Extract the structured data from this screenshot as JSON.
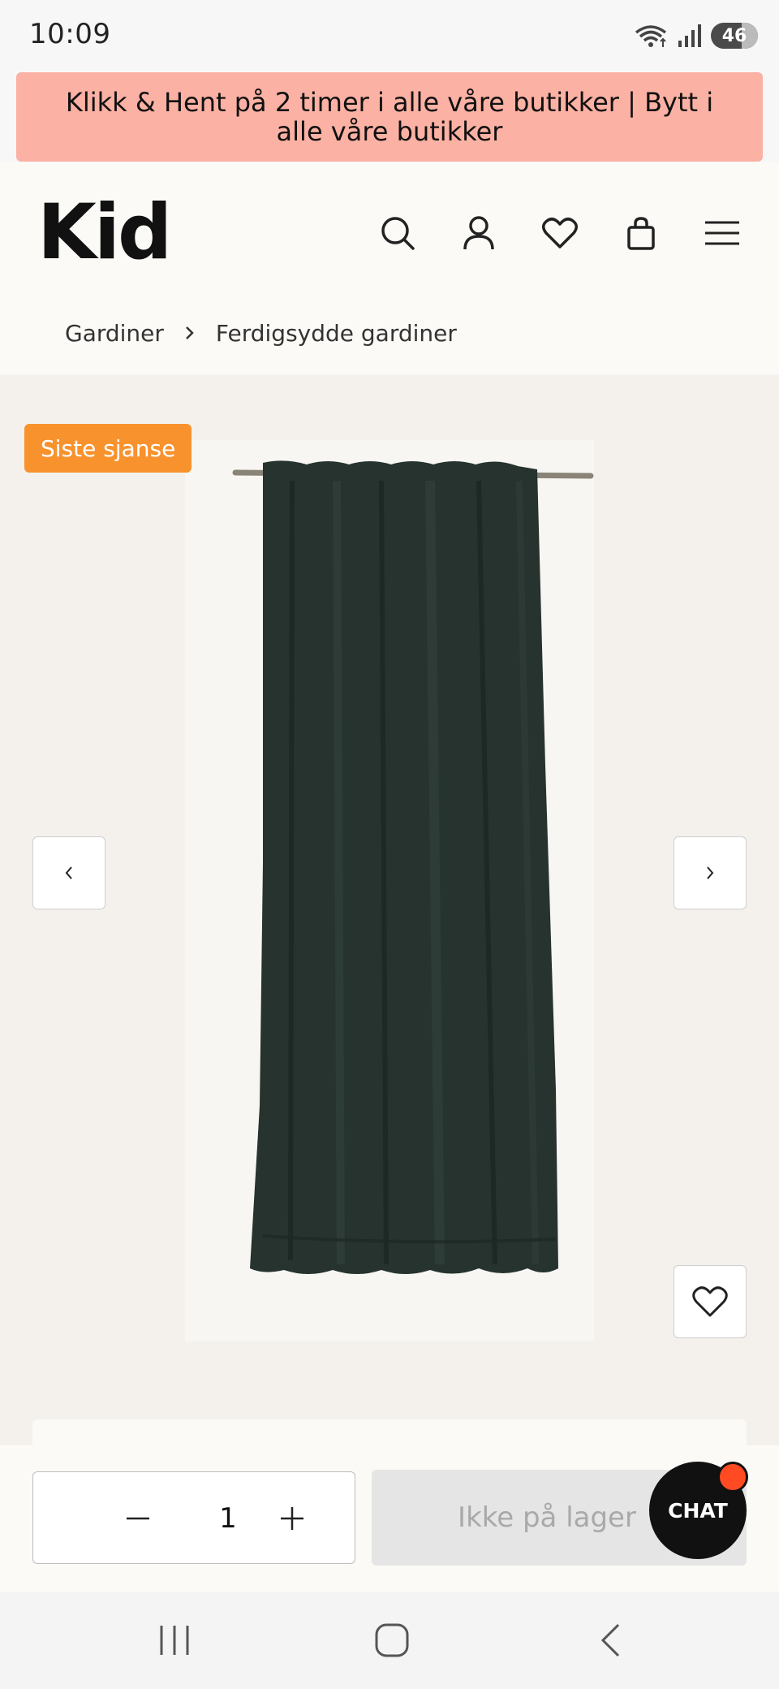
{
  "status_bar": {
    "time": "10:09",
    "battery": "46"
  },
  "promo": {
    "text": "Klikk & Hent på 2 timer i alle våre butikker | Bytt i alle våre butikker"
  },
  "header": {
    "logo_text": "Kid",
    "icons": [
      "search-icon",
      "account-icon",
      "heart-icon",
      "bag-icon",
      "menu-icon"
    ]
  },
  "breadcrumb": {
    "items": [
      "Gardiner",
      "Ferdigsydde gardiner"
    ]
  },
  "gallery": {
    "badge": "Siste sjanse"
  },
  "purchase": {
    "quantity": "1",
    "button_label": "Ikke på lager"
  },
  "chat": {
    "label": "CHAT"
  },
  "colors": {
    "promo_bg": "#fbb1a3",
    "badge_bg": "#f8922d",
    "chat_bg": "#111111",
    "chat_dot": "#ff4a22",
    "curtain": "#26332f"
  }
}
